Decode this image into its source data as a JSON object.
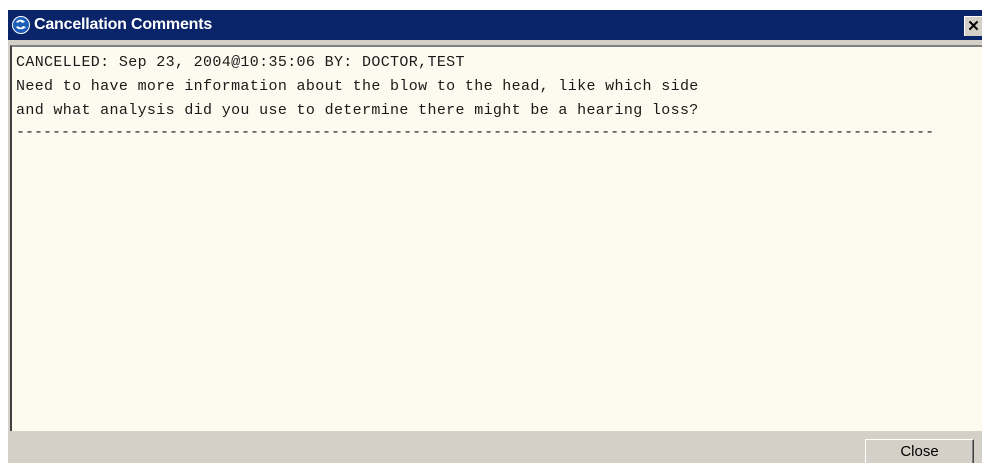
{
  "window": {
    "title": "Cancellation Comments",
    "close_glyph": "✕",
    "title_icon": "app-globe-icon",
    "titlebar_color": "#0a246a"
  },
  "memo": {
    "lines": [
      "CANCELLED: Sep 23, 2004@10:35:06 BY: DOCTOR,TEST",
      "Need to have more information about the blow to the head, like which side",
      "and what analysis did you use to determine there might be a hearing loss?",
      "------------------------------------------------------------------------------------------------------"
    ],
    "background_color": "#fdfbef"
  },
  "buttons": {
    "close_label": "Close"
  }
}
